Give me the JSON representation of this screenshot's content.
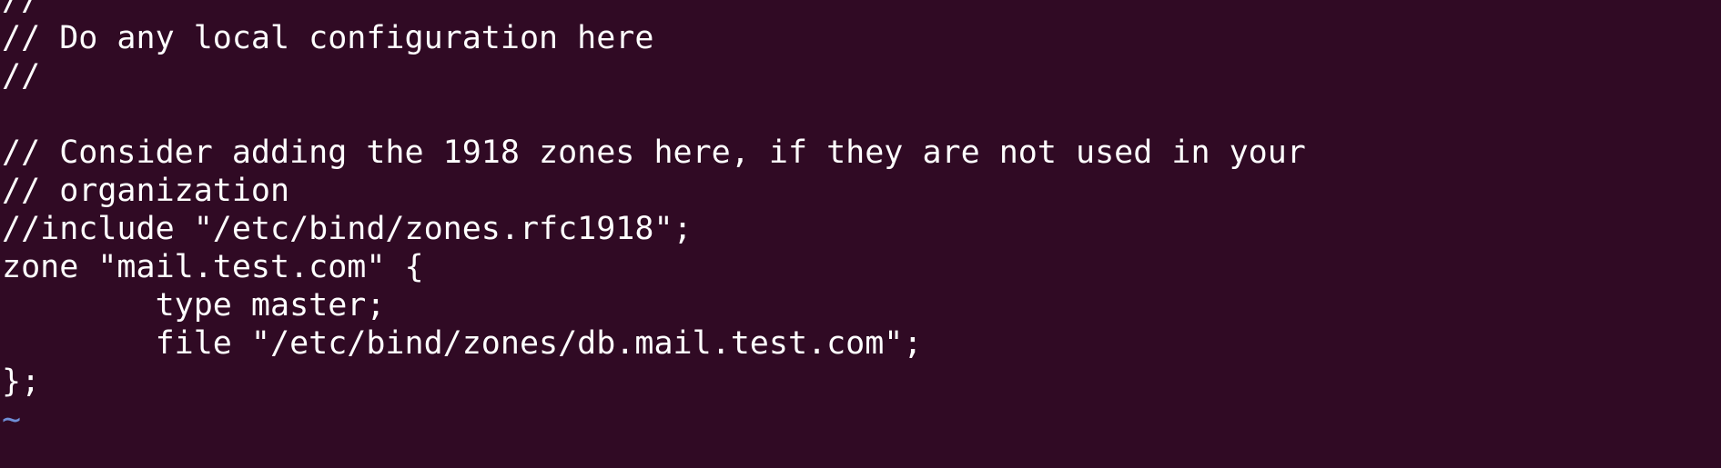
{
  "editor": {
    "lines": [
      "//",
      "// Do any local configuration here",
      "//",
      "",
      "// Consider adding the 1918 zones here, if they are not used in your",
      "// organization",
      "//include \"/etc/bind/zones.rfc1918\";",
      "zone \"mail.test.com\" {",
      "        type master;",
      "        file \"/etc/bind/zones/db.mail.test.com\";",
      "};"
    ],
    "empty_line_marker": "~"
  },
  "colors": {
    "background": "#300a24",
    "text": "#ffffff",
    "tilde": "#6f8fd6"
  }
}
